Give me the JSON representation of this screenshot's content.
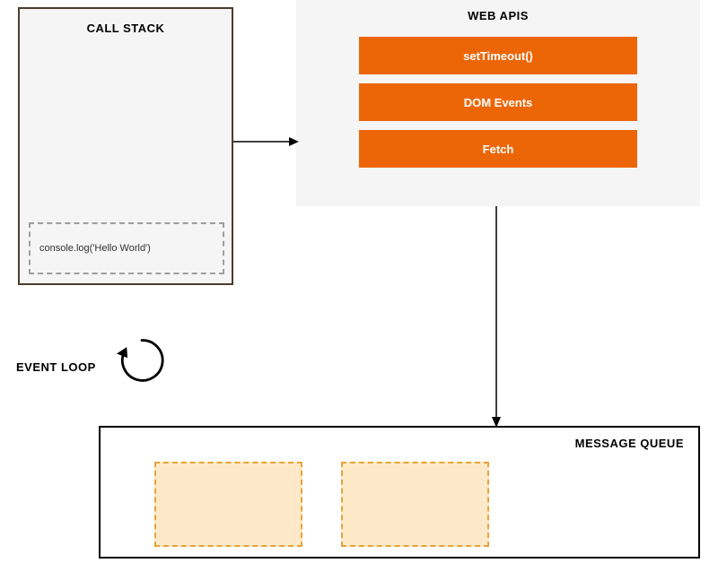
{
  "call_stack": {
    "title": "CALL STACK",
    "frame": "console.log('Hello World')"
  },
  "web_apis": {
    "title": "WEB APIS",
    "items": [
      "setTimeout()",
      "DOM Events",
      "Fetch"
    ]
  },
  "event_loop": {
    "label": "EVENT LOOP"
  },
  "message_queue": {
    "title": "MESSAGE QUEUE"
  },
  "colors": {
    "api_box": "#ec6608",
    "queue_item_fill": "#fde9c8",
    "queue_item_border": "#e6a33a",
    "panel_bg": "#f5f5f5"
  }
}
